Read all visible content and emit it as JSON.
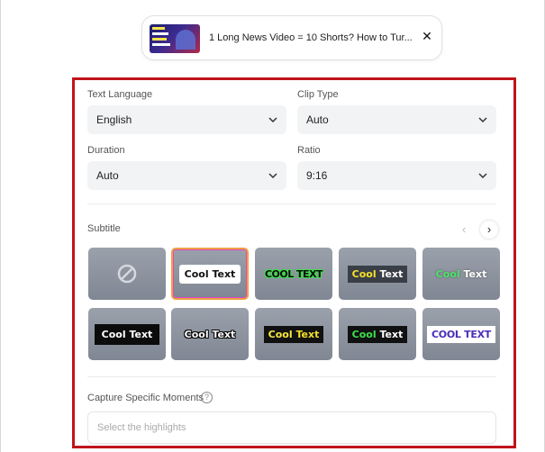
{
  "video": {
    "title": "1 Long News Video = 10 Shorts? How to Tur...",
    "close_symbol": "✕"
  },
  "settings": {
    "text_language": {
      "label": "Text Language",
      "value": "English"
    },
    "clip_type": {
      "label": "Clip Type",
      "value": "Auto"
    },
    "duration": {
      "label": "Duration",
      "value": "Auto"
    },
    "ratio": {
      "label": "Ratio",
      "value": "9:16"
    }
  },
  "subtitle": {
    "label": "Subtitle",
    "prev_symbol": "‹",
    "next_symbol": "›",
    "selected_index": 1,
    "styles": [
      {
        "name": "none",
        "text": ""
      },
      {
        "name": "white-box",
        "text": "Cool Text"
      },
      {
        "name": "outline-green",
        "text": "COOL TEXT"
      },
      {
        "name": "dark-yellow",
        "text": "Cool Text",
        "accent": "Cool",
        "rest": " Text"
      },
      {
        "name": "green-white",
        "text": "Cool Text",
        "accent": "Cool",
        "rest": " Text"
      },
      {
        "name": "black-box",
        "text": "Cool Text"
      },
      {
        "name": "outline-black",
        "text": "Cool Text"
      },
      {
        "name": "yellow-black",
        "text": "Cool Text",
        "accent": "Cool",
        "rest": " Text"
      },
      {
        "name": "green-black",
        "text": "Cool Text",
        "accent": "Cool",
        "rest": " Text"
      },
      {
        "name": "white-purple",
        "text": "COOL TEXT"
      }
    ]
  },
  "capture": {
    "label": "Capture Specific Moments",
    "help_symbol": "?",
    "placeholder": "Select the highlights"
  },
  "colors": {
    "panel_border": "#c0141b",
    "select_bg": "#f2f3f5",
    "selected_tile_border": "#f0a040"
  }
}
